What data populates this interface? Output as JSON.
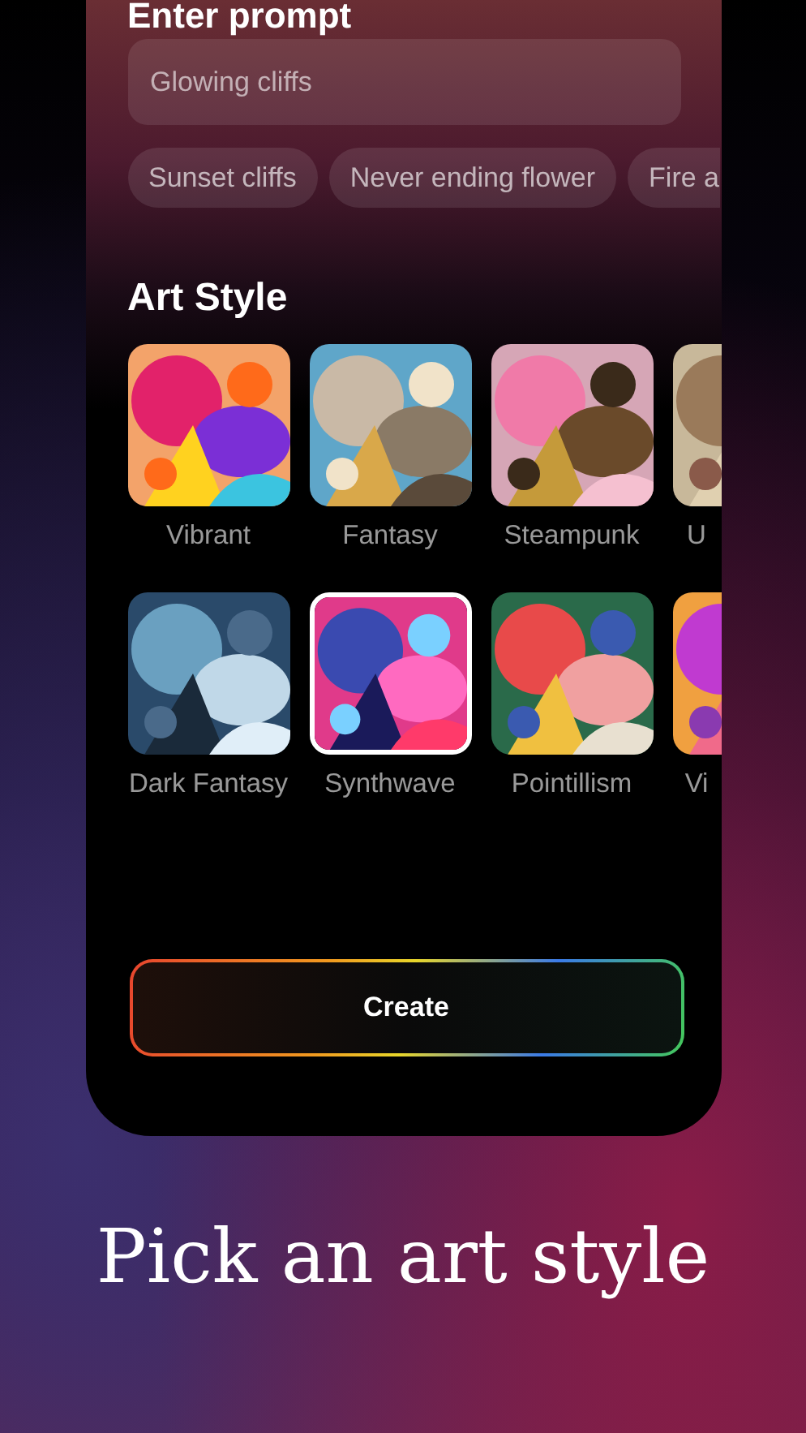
{
  "prompt": {
    "heading": "Enter prompt",
    "placeholder": "Glowing cliffs"
  },
  "suggestions": [
    {
      "label": "Sunset cliffs",
      "cut": false
    },
    {
      "label": "Never ending flower",
      "cut": false
    },
    {
      "label": "Fire a",
      "cut": true
    }
  ],
  "art_style": {
    "heading": "Art Style",
    "rows": [
      [
        {
          "label": "Vibrant",
          "selected": false,
          "cut": false
        },
        {
          "label": "Fantasy",
          "selected": false,
          "cut": false
        },
        {
          "label": "Steampunk",
          "selected": false,
          "cut": false
        },
        {
          "label": "U",
          "selected": false,
          "cut": true
        }
      ],
      [
        {
          "label": "Dark Fantasy",
          "selected": false,
          "cut": false
        },
        {
          "label": "Synthwave",
          "selected": true,
          "cut": false
        },
        {
          "label": "Pointillism",
          "selected": false,
          "cut": false
        },
        {
          "label": "Vi",
          "selected": false,
          "cut": true
        }
      ]
    ]
  },
  "create_button": "Create",
  "caption": "Pick an art style"
}
